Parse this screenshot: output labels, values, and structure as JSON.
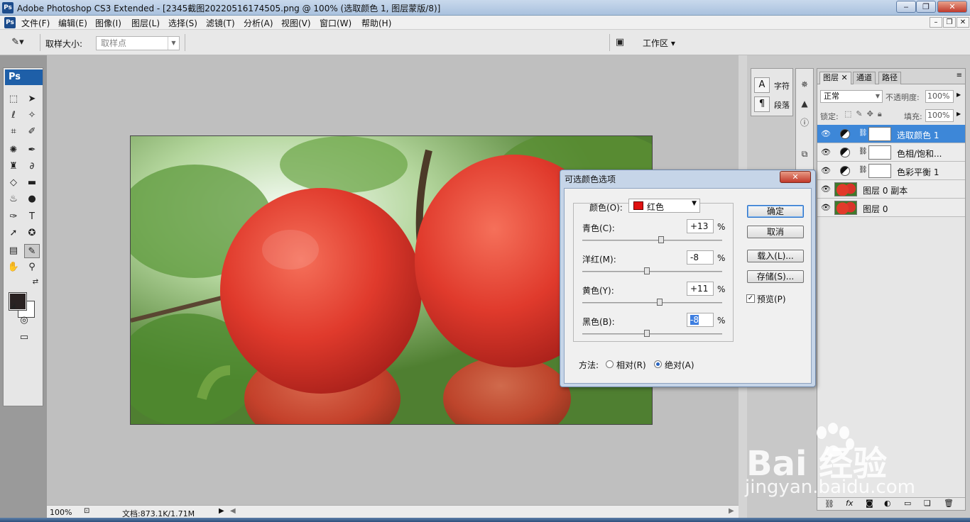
{
  "window": {
    "title": "Adobe Photoshop CS3 Extended - [2345截图20220516174505.png @ 100% (选取颜色 1, 图层蒙版/8)]",
    "app_logo": "Ps"
  },
  "menu": {
    "items": [
      "文件(F)",
      "编辑(E)",
      "图像(I)",
      "图层(L)",
      "选择(S)",
      "滤镜(T)",
      "分析(A)",
      "视图(V)",
      "窗口(W)",
      "帮助(H)"
    ]
  },
  "options": {
    "sample_size_label": "取样大小:",
    "sample_size_value": "取样点",
    "workspace_label": "工作区 ▾"
  },
  "toolbox": {
    "header": "Ps"
  },
  "status": {
    "zoom": "100%",
    "doc_info": "文档:873.1K/1.71M"
  },
  "char_panel": {
    "character": "字符",
    "paragraph": "段落"
  },
  "layers_panel": {
    "tabs": [
      "图层",
      "通道",
      "路径"
    ],
    "blend_mode": "正常",
    "opacity_label": "不透明度:",
    "opacity_value": "100%",
    "lock_label": "锁定:",
    "fill_label": "填充:",
    "fill_value": "100%",
    "layers": [
      {
        "name": "选取颜色 1",
        "selected": true
      },
      {
        "name": "色相/饱和...",
        "selected": false
      },
      {
        "name": "色彩平衡 1",
        "selected": false
      },
      {
        "name": "图层 0 副本",
        "selected": false
      },
      {
        "name": "图层 0",
        "selected": false
      }
    ]
  },
  "dialog": {
    "title": "可选颜色选项",
    "colors_label": "颜色(O):",
    "colors_value": "红色",
    "swatch_color": "#e01010",
    "sliders": [
      {
        "label": "青色(C):",
        "value": "+13",
        "level": 13
      },
      {
        "label": "洋红(M):",
        "value": "-8",
        "level": -8
      },
      {
        "label": "黄色(Y):",
        "value": "+11",
        "level": 11
      },
      {
        "label": "黑色(B):",
        "value": "-8",
        "level": -8
      }
    ],
    "percent": "%",
    "buttons": {
      "ok": "确定",
      "cancel": "取消",
      "load": "载入(L)...",
      "save": "存储(S)..."
    },
    "preview_label": "预览(P)",
    "preview_checked": true,
    "method_label": "方法:",
    "method_relative": "相对(R)",
    "method_absolute": "绝对(A)",
    "method_selected": "absolute"
  },
  "watermark": {
    "brand": "Bai  经验",
    "url": "jingyan.baidu.com"
  }
}
